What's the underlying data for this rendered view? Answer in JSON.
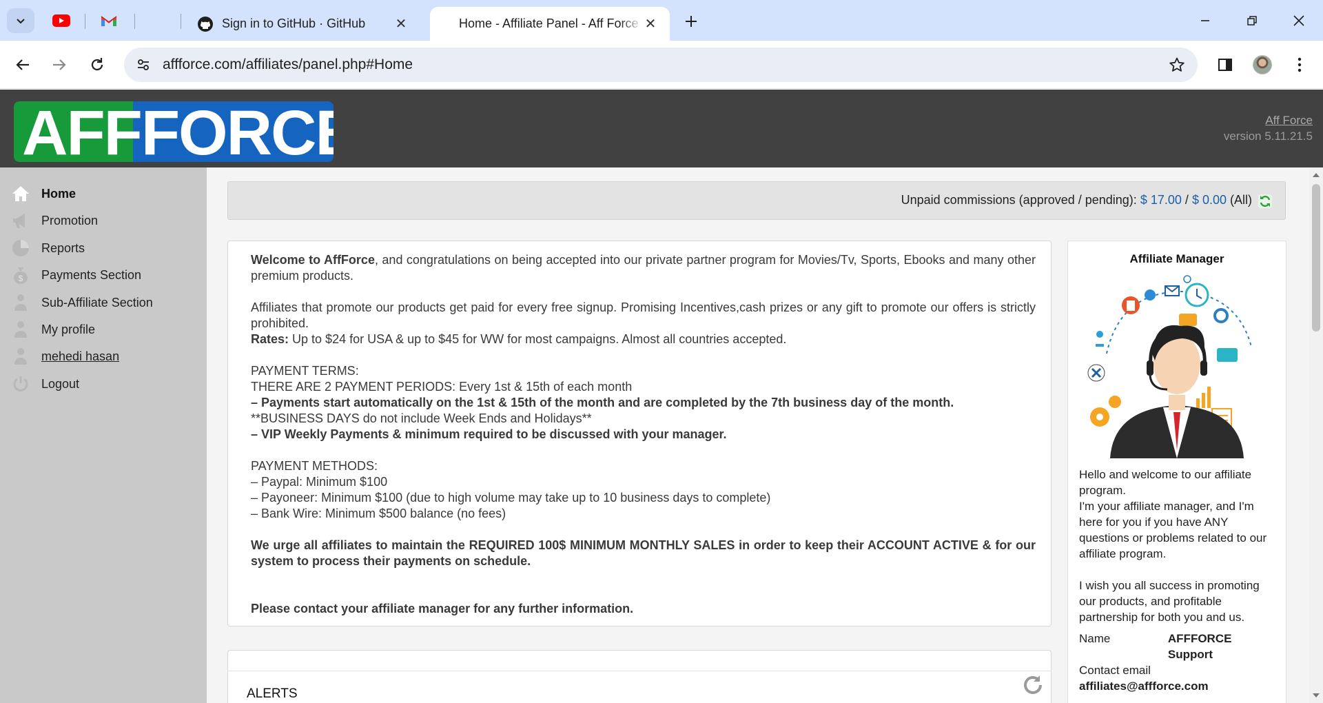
{
  "browser": {
    "tabs": [
      {
        "title": "Sign in to GitHub · GitHub",
        "active": false
      },
      {
        "title": "Home - Affiliate Panel - Aff Force",
        "active": true
      }
    ],
    "address": "affforce.com/affiliates/panel.php#Home"
  },
  "header": {
    "logo_text": "AFFFORCE",
    "brand_link": "Aff Force",
    "version": "version 5.11.21.5"
  },
  "sidebar": {
    "items": [
      {
        "label": "Home",
        "icon": "home-icon"
      },
      {
        "label": "Promotion",
        "icon": "megaphone-icon"
      },
      {
        "label": "Reports",
        "icon": "chart-icon"
      },
      {
        "label": "Payments Section",
        "icon": "money-bag-icon"
      },
      {
        "label": "Sub-Affiliate Section",
        "icon": "users-icon"
      },
      {
        "label": "My profile",
        "icon": "user-icon"
      },
      {
        "label": "mehedi hasan",
        "icon": "user-icon"
      },
      {
        "label": "Logout",
        "icon": "power-icon"
      }
    ]
  },
  "commissions": {
    "label": "Unpaid commissions (approved / pending):",
    "approved": "$ 17.00",
    "separator": "/",
    "pending": "$ 0.00",
    "scope": "(All)"
  },
  "welcome": {
    "intro_bold": "Welcome to AffForce",
    "intro_rest": ", and congratulations on being accepted into our private partner program for Movies/Tv, Sports, Ebooks and many other premium products.",
    "promote": "Affiliates that promote our products get paid for every free signup. Promising Incentives,cash prizes or any gift to promote our offers is strictly prohibited.",
    "rates_label": "Rates:",
    "rates_text": " Up to $24 for USA & up to $45 for WW for most campaigns. Almost all countries accepted.",
    "terms_heading": "PAYMENT TERMS:",
    "terms_periods": "THERE ARE 2 PAYMENT PERIODS: Every 1st & 15th of each month",
    "terms_start": "– Payments start automatically on the 1st & 15th of the month and are completed by the 7th business day of the month.",
    "terms_days": "**BUSINESS DAYS do not include Week Ends and Holidays**",
    "terms_vip": "– VIP Weekly Payments & minimum required to be discussed with your manager.",
    "methods_heading": "PAYMENT METHODS:",
    "method_paypal": "– Paypal: Minimum $100",
    "method_payoneer": "– Payoneer: Minimum $100 (due to high volume may take up to 10 business days to complete)",
    "method_wire": "– Bank Wire: Minimum $500 balance (no fees)",
    "urge": "We urge all affiliates to maintain the REQUIRED 100$ MINIMUM MONTHLY SALES in order to keep their ACCOUNT ACTIVE & for our system to process their payments on schedule.",
    "contact": "Please contact your affiliate manager for any further information."
  },
  "manager": {
    "title": "Affiliate Manager",
    "greeting": "Hello and welcome to our affiliate program.",
    "intro": "I'm your affiliate manager, and I'm here for you if you have ANY questions or problems related to our affiliate program.",
    "wish": "I wish you all success in promoting our products, and profitable partnership for both you and us.",
    "name_label": "Name",
    "name_value": "AFFFORCE Support",
    "email_label": "Contact email",
    "email_value": "affiliates@affforce.com"
  },
  "alerts": {
    "title": "ALERTS"
  },
  "colors": {
    "header_bg": "#414141",
    "sidebar_bg": "#c9c9c9",
    "logo_green": "#179b3a",
    "logo_blue": "#1565c0",
    "amount_blue": "#1c5fa8"
  }
}
